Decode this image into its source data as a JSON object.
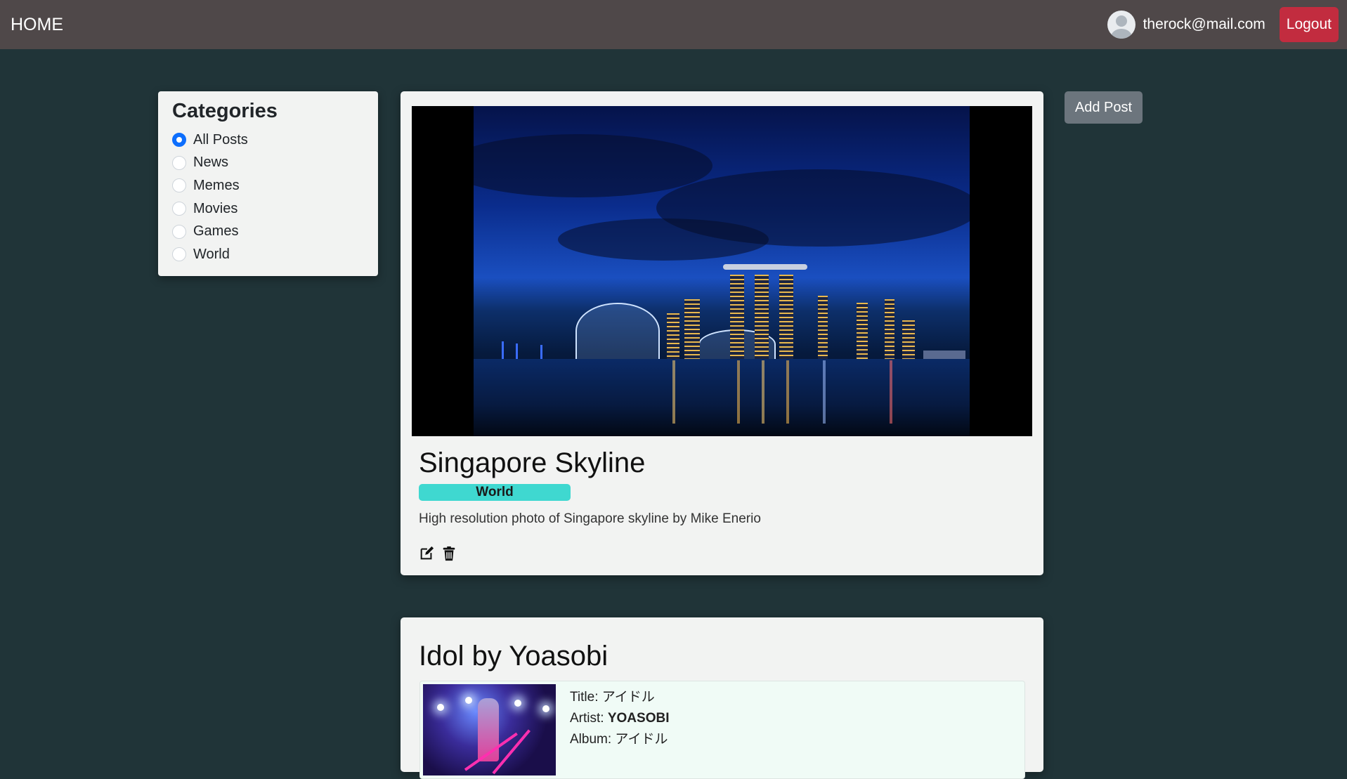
{
  "navbar": {
    "brand": "HOME",
    "user_email": "therock@mail.com",
    "logout_label": "Logout"
  },
  "categories": {
    "title": "Categories",
    "items": [
      {
        "label": "All Posts",
        "checked": true
      },
      {
        "label": "News",
        "checked": false
      },
      {
        "label": "Memes",
        "checked": false
      },
      {
        "label": "Movies",
        "checked": false
      },
      {
        "label": "Games",
        "checked": false
      },
      {
        "label": "World",
        "checked": false
      }
    ]
  },
  "add_post_label": "Add Post",
  "posts": [
    {
      "title": "Singapore Skyline",
      "category": "World",
      "description": "High resolution photo of Singapore skyline by Mike Enerio"
    },
    {
      "title": "Idol by Yoasobi",
      "music": {
        "title_label": "Title:",
        "title_value": "アイドル",
        "artist_label": "Artist:",
        "artist_value": "YOASOBI",
        "album_label": "Album:",
        "album_value": "アイドル"
      }
    }
  ],
  "colors": {
    "page_bg": "#203438",
    "navbar_bg": "#4f4849",
    "logout_bg": "#c22c3f",
    "badge_bg": "#3fd8d0",
    "add_post_bg": "#6c757d",
    "radio_checked": "#0d6efd"
  },
  "icons": [
    "avatar-icon",
    "edit-icon",
    "trash-icon"
  ]
}
